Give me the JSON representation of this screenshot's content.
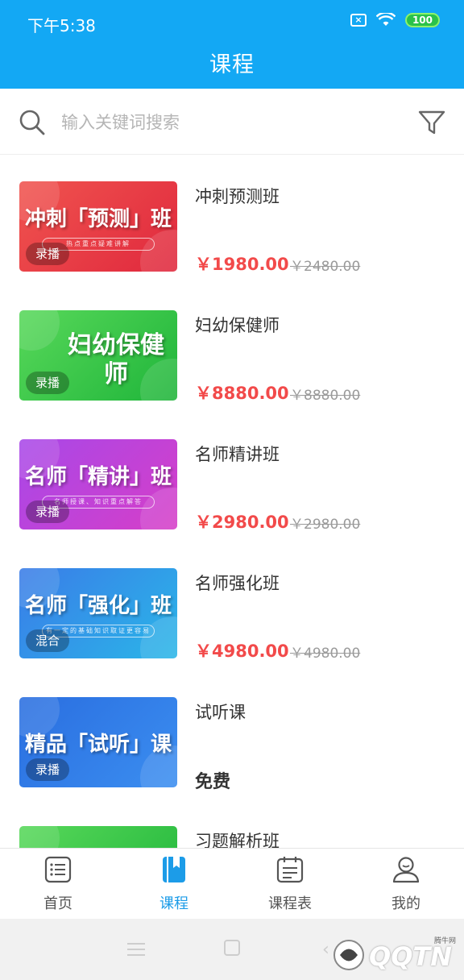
{
  "status_bar": {
    "time": "下午5:38",
    "battery": "100"
  },
  "header": {
    "title": "课程"
  },
  "search": {
    "placeholder": "输入关键词搜索"
  },
  "courses": [
    {
      "title": "冲刺预测班",
      "thumb_text": "冲刺「预测」班",
      "thumb_sub": "热点重点疑难讲解",
      "type": "录播",
      "price": "￥1980.00",
      "original_price": "￥2480.00"
    },
    {
      "title": "妇幼保健师",
      "thumb_text": "妇幼保健师",
      "type": "录播",
      "price": "￥8880.00",
      "original_price": "￥8880.00"
    },
    {
      "title": "名师精讲班",
      "thumb_text": "名师「精讲」班",
      "thumb_sub": "名师授课、知识重点解答",
      "type": "录播",
      "price": "￥2980.00",
      "original_price": "￥2980.00"
    },
    {
      "title": "名师强化班",
      "thumb_text": "名师「强化」班",
      "thumb_sub": "有一定的基础知识取证更容易",
      "type": "混合",
      "price": "￥4980.00",
      "original_price": "￥4980.00"
    },
    {
      "title": "试听课",
      "thumb_text": "精品「试听」课",
      "type": "录播",
      "free_label": "免费"
    },
    {
      "title": "习题解析班"
    }
  ],
  "tabs": [
    {
      "label": "首页",
      "icon": "home-list-icon",
      "active": false
    },
    {
      "label": "课程",
      "icon": "bookmark-icon",
      "active": true
    },
    {
      "label": "课程表",
      "icon": "schedule-icon",
      "active": false
    },
    {
      "label": "我的",
      "icon": "user-icon",
      "active": false
    }
  ],
  "watermark": {
    "text": "QQTN",
    "small": "腾牛网"
  },
  "colors": {
    "primary": "#13a8f4",
    "price": "#f24a4a",
    "active_tab": "#1c9ce8"
  }
}
